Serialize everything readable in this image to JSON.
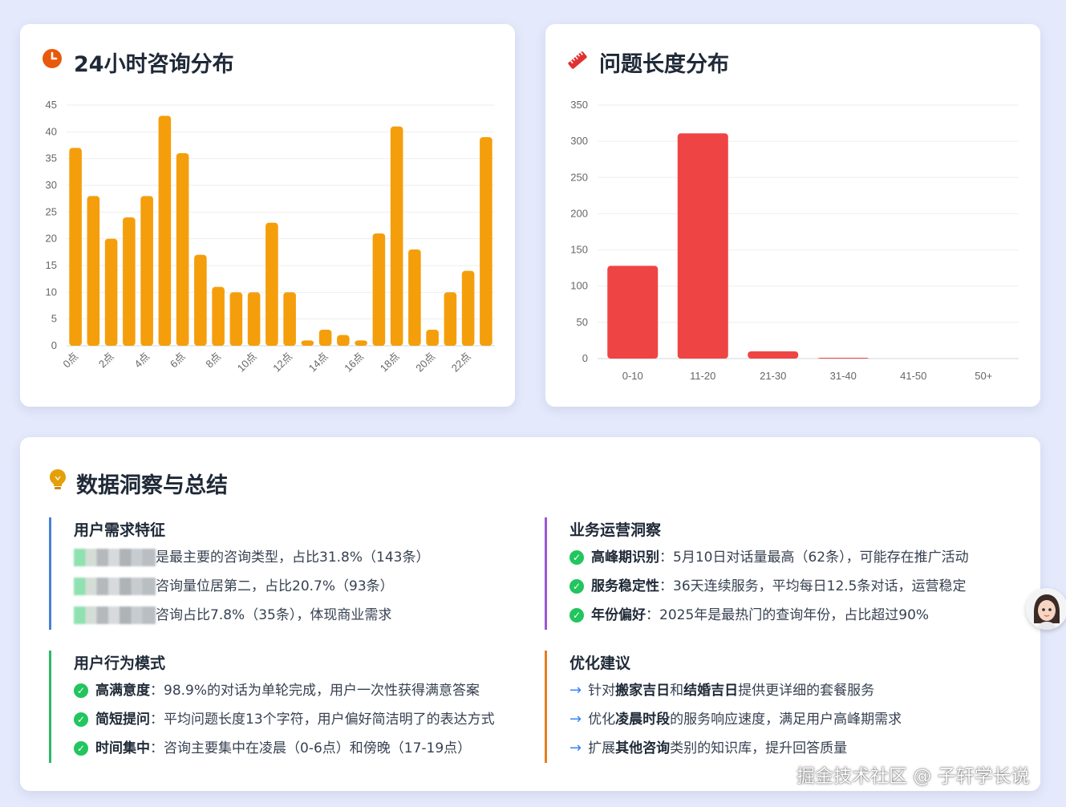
{
  "hour_card": {
    "title": "24小时咨询分布",
    "icon": "clock-icon",
    "accent": "#e8590c"
  },
  "length_card": {
    "title": "问题长度分布",
    "icon": "ruler-icon",
    "accent": "#e03131"
  },
  "chart_data": [
    {
      "type": "bar",
      "categories": [
        "0点",
        "1点",
        "2点",
        "3点",
        "4点",
        "5点",
        "6点",
        "7点",
        "8点",
        "9点",
        "10点",
        "11点",
        "12点",
        "13点",
        "14点",
        "15点",
        "16点",
        "17点",
        "18点",
        "19点",
        "20点",
        "21点",
        "22点",
        "23点"
      ],
      "tick_labels": [
        "0点",
        "2点",
        "4点",
        "6点",
        "8点",
        "10点",
        "12点",
        "14点",
        "16点",
        "18点",
        "20点",
        "22点"
      ],
      "values": [
        37,
        28,
        20,
        24,
        28,
        43,
        36,
        17,
        11,
        10,
        10,
        23,
        10,
        1,
        3,
        2,
        1,
        21,
        41,
        18,
        3,
        10,
        14,
        39
      ],
      "ylim": [
        0,
        45
      ],
      "yticks": [
        0,
        5,
        10,
        15,
        20,
        25,
        30,
        35,
        40,
        45
      ],
      "grid": true,
      "color": "#f59e0b"
    },
    {
      "type": "bar",
      "categories": [
        "0-10",
        "11-20",
        "21-30",
        "31-40",
        "41-50",
        "50+"
      ],
      "values": [
        128,
        311,
        10,
        1,
        0,
        0
      ],
      "ylim": [
        0,
        350
      ],
      "yticks": [
        0,
        50,
        100,
        150,
        200,
        250,
        300,
        350
      ],
      "grid": true,
      "color": "#ef4444"
    }
  ],
  "insights": {
    "title": "数据洞察与总结",
    "icon": "lightbulb-icon",
    "sections": [
      {
        "title": "用户需求特征",
        "color": "#4a7fd4",
        "items": [
          {
            "bold": "",
            "text": "是最主要的咨询类型，占比31.8%（143条）"
          },
          {
            "bold": "",
            "text": "咨询量位居第二，占比20.7%（93条）"
          },
          {
            "bold": "",
            "text": "咨询占比7.8%（35条），体现商业需求"
          }
        ]
      },
      {
        "title": "业务运营洞察",
        "color": "#9b59d0",
        "items": [
          {
            "bold": "高峰期识别",
            "text": "：5月10日对话量最高（62条），可能存在推广活动"
          },
          {
            "bold": "服务稳定性",
            "text": "：36天连续服务，平均每日12.5条对话，运营稳定"
          },
          {
            "bold": "年份偏好",
            "text": "：2025年是最热门的查询年份，占比超过90%"
          }
        ]
      },
      {
        "title": "用户行为模式",
        "color": "#2fb866",
        "items": [
          {
            "bold": "高满意度",
            "text": "：98.9%的对话为单轮完成，用户一次性获得满意答案"
          },
          {
            "bold": "简短提问",
            "text": "：平均问题长度13个字符，用户偏好简洁明了的表达方式"
          },
          {
            "bold": "时间集中",
            "text": "：咨询主要集中在凌晨（0-6点）和傍晚（17-19点）"
          }
        ]
      },
      {
        "title": "优化建议",
        "color": "#e67e22",
        "items": [
          {
            "parts": [
              {
                "t": "针对",
                "b": false
              },
              {
                "t": "搬家吉日",
                "b": true
              },
              {
                "t": "和",
                "b": false
              },
              {
                "t": "结婚吉日",
                "b": true
              },
              {
                "t": "提供更详细的套餐服务",
                "b": false
              }
            ]
          },
          {
            "parts": [
              {
                "t": "优化",
                "b": false
              },
              {
                "t": "凌晨时段",
                "b": true
              },
              {
                "t": "的服务响应速度，满足用户高峰期需求",
                "b": false
              }
            ]
          },
          {
            "parts": [
              {
                "t": "扩展",
                "b": false
              },
              {
                "t": "其他咨询",
                "b": true
              },
              {
                "t": "类别的知识库，提升回答质量",
                "b": false
              }
            ]
          }
        ]
      }
    ]
  },
  "watermark": "掘金技术社区 @ 子轩学长说"
}
